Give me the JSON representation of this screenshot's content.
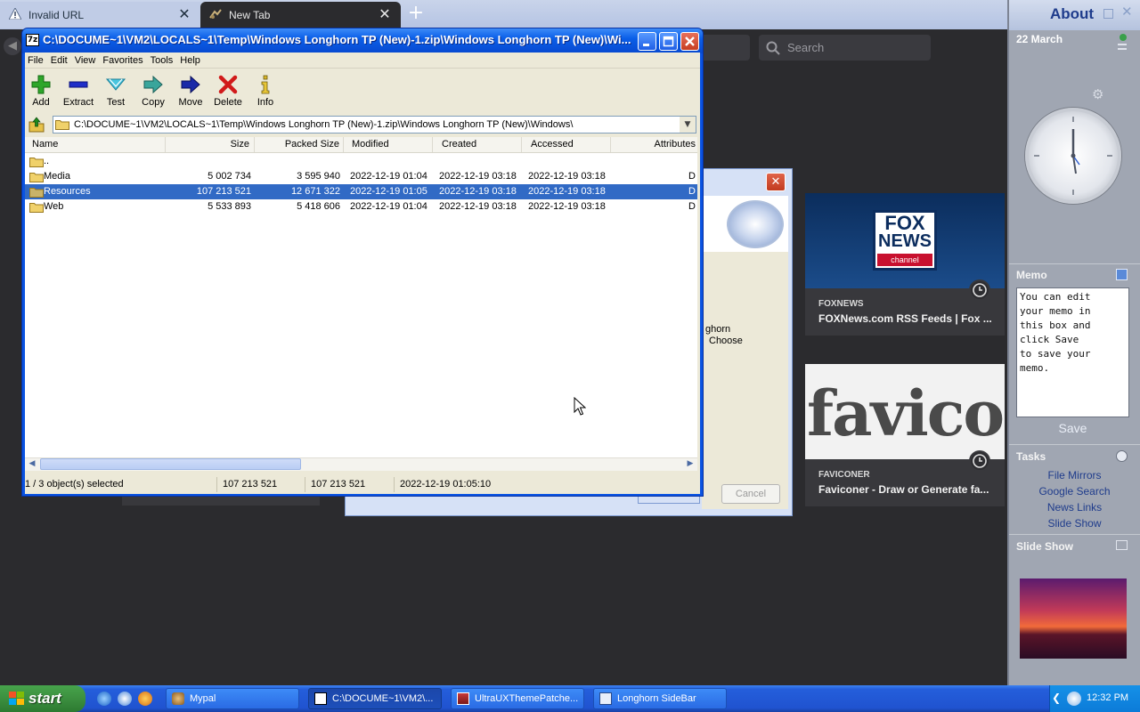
{
  "browser": {
    "tabs": [
      {
        "label": "Invalid URL",
        "icon": "warning-icon"
      },
      {
        "label": "New Tab",
        "icon": "new-tab-icon"
      }
    ],
    "search_placeholder": "Search",
    "cards": [
      {
        "site": "FOXNEWS",
        "title": "FOXNews.com RSS Feeds | Fox ...",
        "thumb_lines": [
          "FOX",
          "NEWS",
          "channel"
        ]
      },
      {
        "site": "FAVICONER",
        "title": "Faviconer - Draw or Generate fa...",
        "thumb_text": "favico"
      }
    ]
  },
  "dialog": {
    "text_lines": [
      "ghorn",
      "Choose"
    ],
    "cancel_label": "Cancel",
    "close_label": "✕"
  },
  "zip_window": {
    "icon_label": "7z",
    "title": "C:\\DOCUME~1\\VM2\\LOCALS~1\\Temp\\Windows Longhorn TP (New)-1.zip\\Windows Longhorn TP (New)\\Wi...",
    "menu": [
      "File",
      "Edit",
      "View",
      "Favorites",
      "Tools",
      "Help"
    ],
    "toolbar": [
      {
        "label": "Add",
        "icon": "add-icon"
      },
      {
        "label": "Extract",
        "icon": "extract-icon"
      },
      {
        "label": "Test",
        "icon": "test-icon"
      },
      {
        "label": "Copy",
        "icon": "copy-icon"
      },
      {
        "label": "Move",
        "icon": "move-icon"
      },
      {
        "label": "Delete",
        "icon": "delete-icon"
      },
      {
        "label": "Info",
        "icon": "info-icon"
      }
    ],
    "path": "C:\\DOCUME~1\\VM2\\LOCALS~1\\Temp\\Windows Longhorn TP (New)-1.zip\\Windows Longhorn TP (New)\\Windows\\",
    "columns": [
      "Name",
      "Size",
      "Packed Size",
      "Modified",
      "Created",
      "Accessed",
      "Attributes"
    ],
    "rows": [
      {
        "name": "..",
        "size": "",
        "packed": "",
        "modified": "",
        "created": "",
        "accessed": "",
        "attr": ""
      },
      {
        "name": "Media",
        "size": "5 002 734",
        "packed": "3 595 940",
        "modified": "2022-12-19 01:04",
        "created": "2022-12-19 03:18",
        "accessed": "2022-12-19 03:18",
        "attr": "D"
      },
      {
        "name": "Resources",
        "size": "107 213 521",
        "packed": "12 671 322",
        "modified": "2022-12-19 01:05",
        "created": "2022-12-19 03:18",
        "accessed": "2022-12-19 03:18",
        "attr": "D",
        "selected": true
      },
      {
        "name": "Web",
        "size": "5 533 893",
        "packed": "5 418 606",
        "modified": "2022-12-19 01:04",
        "created": "2022-12-19 03:18",
        "accessed": "2022-12-19 03:18",
        "attr": "D"
      }
    ],
    "status": {
      "selection": "1 / 3 object(s) selected",
      "size": "107 213 521",
      "packed": "107 213 521",
      "modified": "2022-12-19 01:05:10"
    }
  },
  "sidebar": {
    "title": "About",
    "date": "22 March",
    "memo_title": "Memo",
    "memo_text": "You can edit\nyour memo in\nthis box and\nclick Save\nto save your\nmemo.",
    "memo_save": "Save",
    "tasks_title": "Tasks",
    "tasks": [
      "File Mirrors",
      "Google Search",
      "News Links",
      "Slide Show"
    ],
    "slideshow_title": "Slide Show"
  },
  "taskbar": {
    "start_label": "start",
    "buttons": [
      {
        "label": "Mypal",
        "active": false
      },
      {
        "label": "C:\\DOCUME~1\\VM2\\...",
        "active": true
      },
      {
        "label": "UltraUXThemePatche...",
        "active": false
      },
      {
        "label": "Longhorn SideBar",
        "active": false
      }
    ],
    "time": "12:32 PM"
  },
  "colors": {
    "xp_blue": "#0a53e2",
    "selection": "#316ac5",
    "browser_bg": "#2b2b2e",
    "taskbar": "#245edb",
    "start_green": "#3c8f3f"
  }
}
